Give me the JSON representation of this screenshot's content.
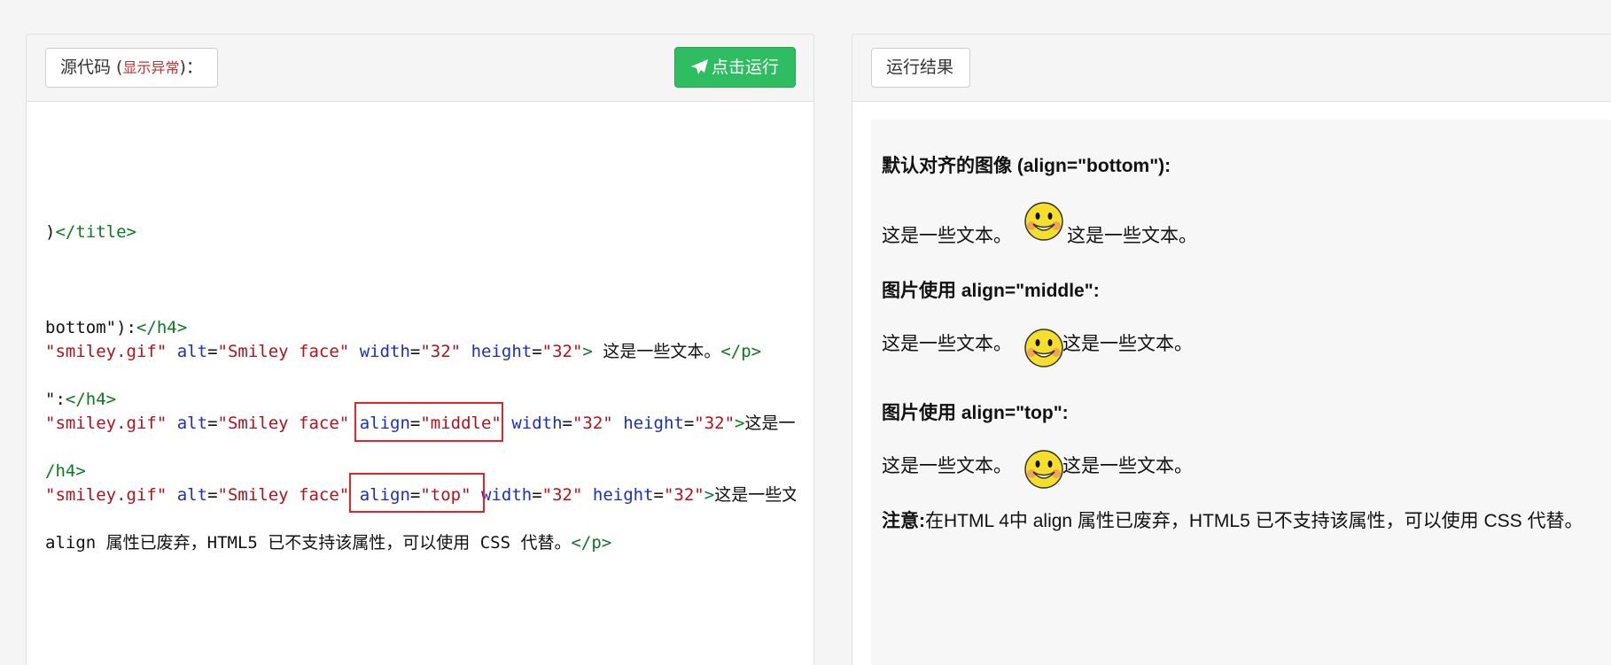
{
  "source_panel": {
    "label_prefix": "源代码 (",
    "error_toggle": "显示异常",
    "label_suffix": ")：",
    "run_button": "点击运行"
  },
  "code_lines": {
    "l1": [
      {
        "c": "p",
        "s": ")"
      },
      {
        "c": "t",
        "s": "</title>"
      }
    ],
    "l2": [
      {
        "c": "p",
        "s": "bottom\"):"
      },
      {
        "c": "t",
        "s": "</h4>"
      }
    ],
    "l3": [
      {
        "c": "v",
        "s": "\"smiley.gif\""
      },
      {
        "c": "p",
        "s": " "
      },
      {
        "c": "a",
        "s": "alt"
      },
      {
        "c": "p",
        "s": "="
      },
      {
        "c": "v",
        "s": "\"Smiley face\""
      },
      {
        "c": "p",
        "s": " "
      },
      {
        "c": "a",
        "s": "width"
      },
      {
        "c": "p",
        "s": "="
      },
      {
        "c": "v",
        "s": "\"32\""
      },
      {
        "c": "p",
        "s": " "
      },
      {
        "c": "a",
        "s": "height"
      },
      {
        "c": "p",
        "s": "="
      },
      {
        "c": "v",
        "s": "\"32\""
      },
      {
        "c": "t",
        "s": ">"
      },
      {
        "c": "p",
        "s": " 这是一些文本。"
      },
      {
        "c": "t",
        "s": "</p>"
      }
    ],
    "l4": [
      {
        "c": "p",
        "s": "\":"
      },
      {
        "c": "t",
        "s": "</h4>"
      }
    ],
    "l5": [
      {
        "c": "v",
        "s": "\"smiley.gif\""
      },
      {
        "c": "p",
        "s": " "
      },
      {
        "c": "a",
        "s": "alt"
      },
      {
        "c": "p",
        "s": "="
      },
      {
        "c": "v",
        "s": "\"Smiley face\""
      },
      {
        "c": "p",
        "s": " "
      },
      {
        "c": "a",
        "s": "align"
      },
      {
        "c": "p",
        "s": "="
      },
      {
        "c": "v",
        "s": "\"middle\""
      },
      {
        "c": "p",
        "s": " "
      },
      {
        "c": "a",
        "s": "width"
      },
      {
        "c": "p",
        "s": "="
      },
      {
        "c": "v",
        "s": "\"32\""
      },
      {
        "c": "p",
        "s": " "
      },
      {
        "c": "a",
        "s": "height"
      },
      {
        "c": "p",
        "s": "="
      },
      {
        "c": "v",
        "s": "\"32\""
      },
      {
        "c": "t",
        "s": ">"
      },
      {
        "c": "p",
        "s": "这是一"
      }
    ],
    "l6": [
      {
        "c": "t",
        "s": "/h4>"
      }
    ],
    "l7": [
      {
        "c": "v",
        "s": "\"smiley.gif\""
      },
      {
        "c": "p",
        "s": " "
      },
      {
        "c": "a",
        "s": "alt"
      },
      {
        "c": "p",
        "s": "="
      },
      {
        "c": "v",
        "s": "\"Smiley face\""
      },
      {
        "c": "p",
        "s": " "
      },
      {
        "c": "a",
        "s": "align"
      },
      {
        "c": "p",
        "s": "="
      },
      {
        "c": "v",
        "s": "\"top\""
      },
      {
        "c": "p",
        "s": " "
      },
      {
        "c": "a",
        "s": "width"
      },
      {
        "c": "p",
        "s": "="
      },
      {
        "c": "v",
        "s": "\"32\""
      },
      {
        "c": "p",
        "s": " "
      },
      {
        "c": "a",
        "s": "height"
      },
      {
        "c": "p",
        "s": "="
      },
      {
        "c": "v",
        "s": "\"32\""
      },
      {
        "c": "t",
        "s": ">"
      },
      {
        "c": "p",
        "s": "这是一些文"
      }
    ],
    "l8": [
      {
        "c": "p",
        "s": "align 属性已废弃，HTML5 已不支持该属性，可以使用 CSS 代替。"
      },
      {
        "c": "t",
        "s": "</p>"
      }
    ]
  },
  "result_panel": {
    "label": "运行结果",
    "h4_bottom": "默认对齐的图像 (align=\"bottom\"):",
    "h4_middle": "图片使用 align=\"middle\":",
    "h4_top": "图片使用 align=\"top\":",
    "text": "这是一些文本。",
    "note_label": "注意:",
    "note_text": "在HTML 4中 align 属性已废弃，HTML5 已不支持该属性，可以使用 CSS 代替。"
  },
  "colors": {
    "tag": "#0b7a1f",
    "attribute": "#1a2fc5",
    "value": "#b2121a",
    "run_button": "#2fbd62",
    "highlight": "#e0262c"
  },
  "icons": {
    "run": "paper-plane-icon",
    "image": "smiley-face-icon"
  }
}
